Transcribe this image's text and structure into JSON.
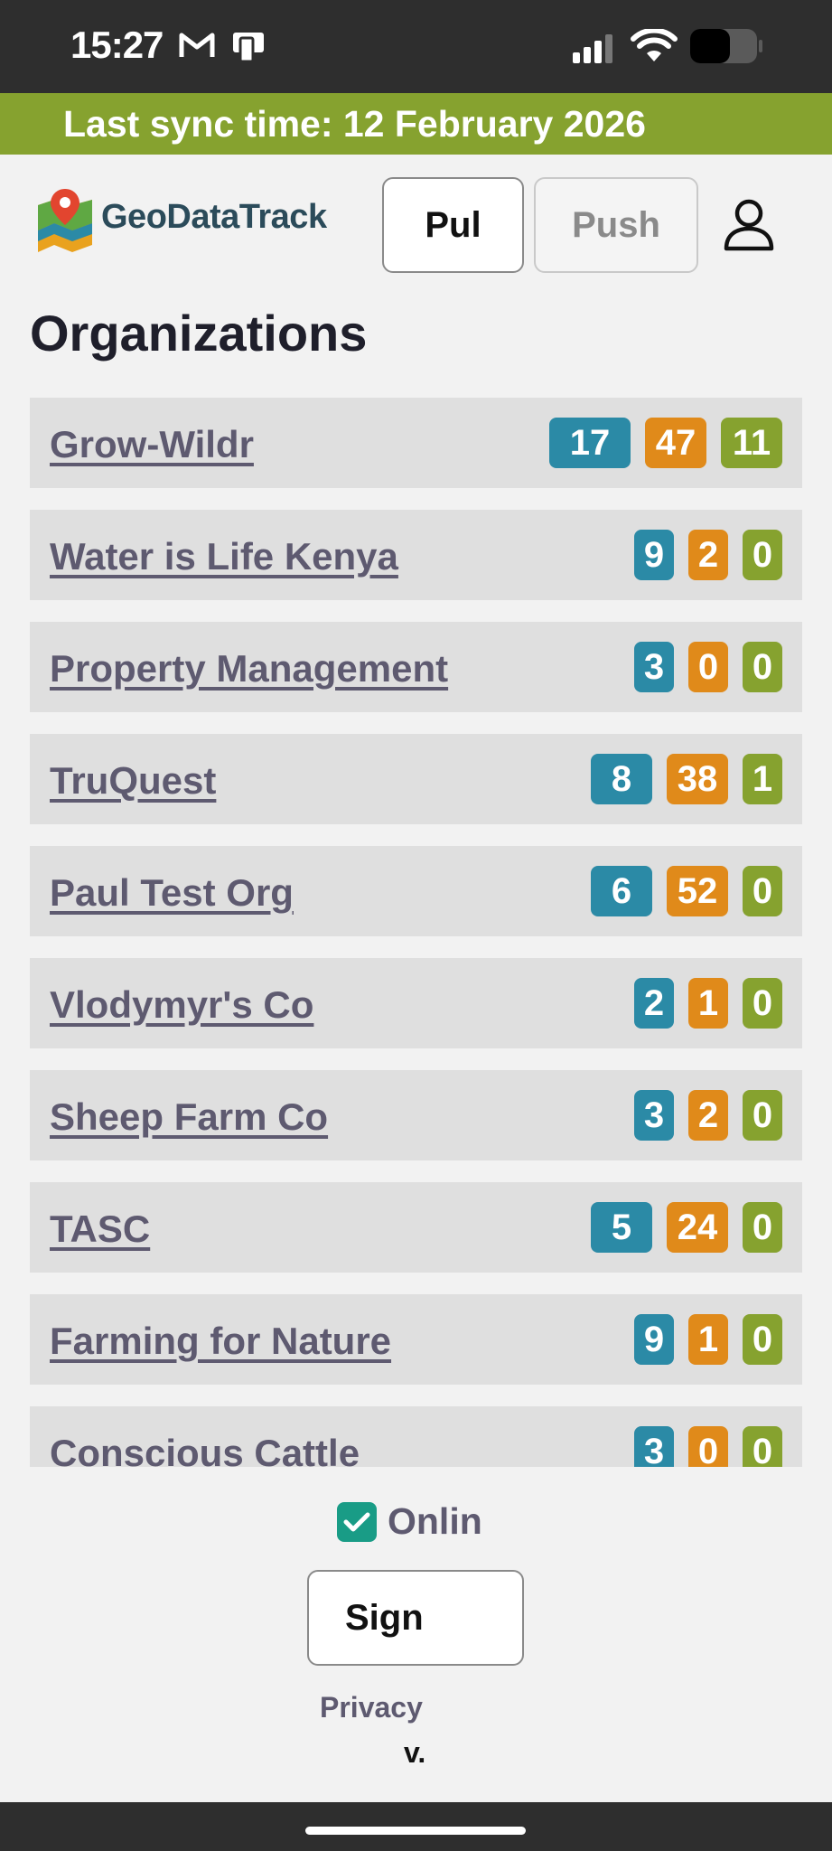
{
  "status_bar": {
    "time": "15:27"
  },
  "sync": {
    "text": "Last sync time: 12 February 2026"
  },
  "header": {
    "logo_text": "GeoDataTrack",
    "pull_label": "Pul",
    "push_label": "Push"
  },
  "page_title": "Organizations",
  "colors": {
    "blue": "#2b8aa6",
    "orange": "#e08a1a",
    "green": "#86a22f",
    "sync_bar": "#86a22f",
    "checkbox": "#199c86"
  },
  "organizations": [
    {
      "name": "Grow-Wildr",
      "counts": [
        "17",
        "47",
        "11"
      ]
    },
    {
      "name": "Water is Life Kenya",
      "counts": [
        "9",
        "2",
        "0"
      ]
    },
    {
      "name": "Property Management",
      "counts": [
        "3",
        "0",
        "0"
      ]
    },
    {
      "name": "TruQuest",
      "counts": [
        "8",
        "38",
        "1"
      ]
    },
    {
      "name": "Paul Test Org",
      "counts": [
        "6",
        "52",
        "0"
      ]
    },
    {
      "name": "Vlodymyr's Co",
      "counts": [
        "2",
        "1",
        "0"
      ]
    },
    {
      "name": "Sheep Farm Co",
      "counts": [
        "3",
        "2",
        "0"
      ]
    },
    {
      "name": "TASC",
      "counts": [
        "5",
        "24",
        "0"
      ]
    },
    {
      "name": "Farming for Nature",
      "counts": [
        "9",
        "1",
        "0"
      ]
    },
    {
      "name": "Conscious Cattle",
      "counts": [
        "3",
        "0",
        "0"
      ]
    }
  ],
  "footer": {
    "online_label": "Onlin",
    "online_checked": true,
    "sign_label": "Sign",
    "privacy_label": "Privacy",
    "version_label": "v."
  }
}
